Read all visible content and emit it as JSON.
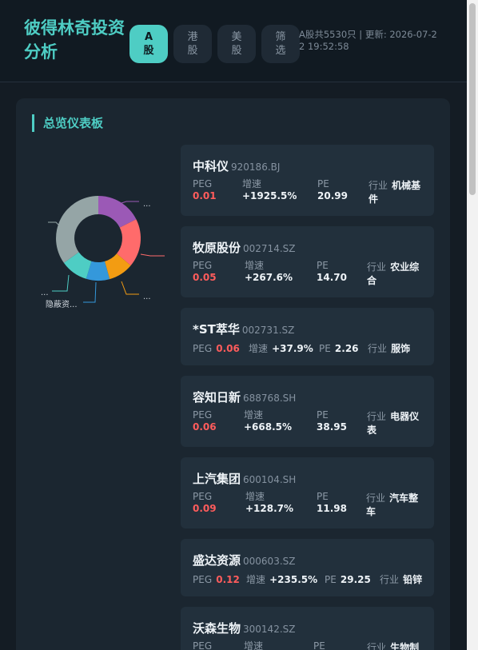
{
  "header": {
    "title": "彼得林奇投资分析",
    "tabs": [
      {
        "label": "A股",
        "active": true
      },
      {
        "label": "港股",
        "active": false
      },
      {
        "label": "美股",
        "active": false
      },
      {
        "label": "筛选",
        "active": false
      }
    ],
    "status": "A股共5530只 | 更新: 2026-07-22 19:52:58"
  },
  "panel": {
    "title": "总览仪表板",
    "donut_labels": [
      "...",
      "...",
      "...",
      "隐蔽资..."
    ]
  },
  "labels": {
    "peg": "PEG",
    "growth": "增速",
    "pe": "PE",
    "industry": "行业"
  },
  "stocks": [
    {
      "name": "中科仪",
      "code": "920186.BJ",
      "peg": "0.01",
      "growth": "+1925.5%",
      "pe": "20.99",
      "industry": "机械基件"
    },
    {
      "name": "牧原股份",
      "code": "002714.SZ",
      "peg": "0.05",
      "growth": "+267.6%",
      "pe": "14.70",
      "industry": "农业综合"
    },
    {
      "name": "*ST萃华",
      "code": "002731.SZ",
      "peg": "0.06",
      "growth": "+37.9%",
      "pe": "2.26",
      "industry": "服饰"
    },
    {
      "name": "容知日新",
      "code": "688768.SH",
      "peg": "0.06",
      "growth": "+668.5%",
      "pe": "38.95",
      "industry": "电器仪表"
    },
    {
      "name": "上汽集团",
      "code": "600104.SH",
      "peg": "0.09",
      "growth": "+128.7%",
      "pe": "11.98",
      "industry": "汽车整车"
    },
    {
      "name": "盛达资源",
      "code": "000603.SZ",
      "peg": "0.12",
      "growth": "+235.5%",
      "pe": "29.25",
      "industry": "铅锌"
    },
    {
      "name": "沃森生物",
      "code": "300142.SZ",
      "peg": "",
      "growth": "",
      "pe": "",
      "industry": "生物制"
    }
  ],
  "colors": {
    "accent": "#4ecdc4",
    "peg": "#ff5c5c",
    "donut": [
      "#9b59b6",
      "#ff6b6b",
      "#f39c12",
      "#3498db",
      "#4ecdc4",
      "#95a5a6"
    ]
  }
}
